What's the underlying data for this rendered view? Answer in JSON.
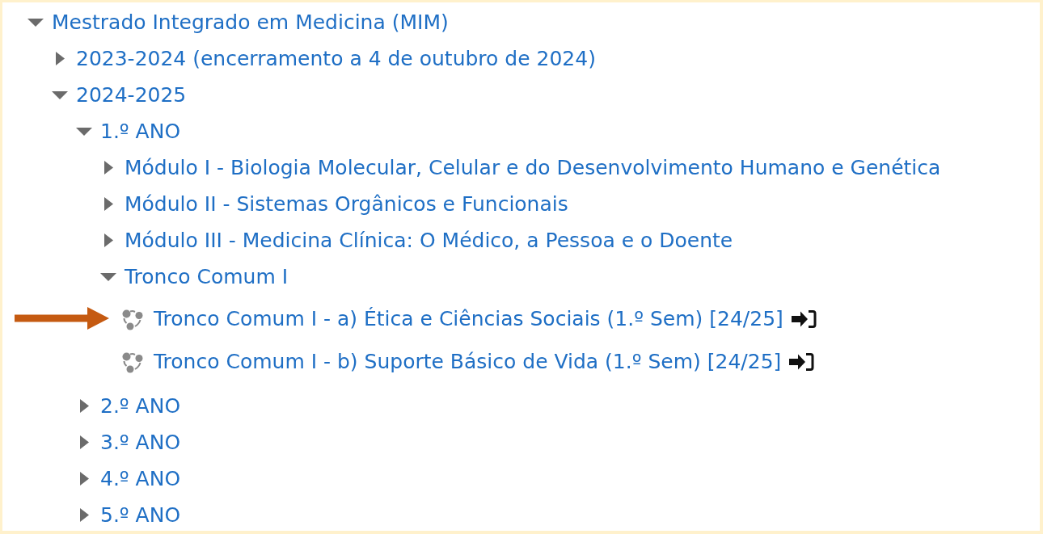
{
  "tree": [
    {
      "kind": "category",
      "label": "Mestrado Integrado em Medicina (MIM)",
      "expanded": true,
      "children": [
        {
          "kind": "category",
          "label": "2023-2024 (encerramento a 4 de outubro de 2024)",
          "expanded": false
        },
        {
          "kind": "category",
          "label": "2024-2025",
          "expanded": true,
          "children": [
            {
              "kind": "category",
              "label": "1.º ANO",
              "expanded": true,
              "children": [
                {
                  "kind": "category",
                  "label": "Módulo I - Biologia Molecular, Celular e do Desenvolvimento Humano e Genética",
                  "expanded": false
                },
                {
                  "kind": "category",
                  "label": "Módulo II - Sistemas Orgânicos e Funcionais",
                  "expanded": false
                },
                {
                  "kind": "category",
                  "label": "Módulo III - Medicina Clínica: O Médico, a Pessoa e o Doente",
                  "expanded": false
                },
                {
                  "kind": "category",
                  "label": "Tronco Comum I",
                  "expanded": true,
                  "children": [
                    {
                      "kind": "course",
                      "label": "Tronco Comum I - a) Ética e Ciências Sociais (1.º Sem) [24/25]",
                      "self_enrol": true,
                      "annotated": true
                    },
                    {
                      "kind": "course",
                      "label": "Tronco Comum I - b) Suporte Básico de Vida (1.º Sem) [24/25]",
                      "self_enrol": true,
                      "annotated": false
                    }
                  ]
                }
              ]
            },
            {
              "kind": "category",
              "label": "2.º ANO",
              "expanded": false
            },
            {
              "kind": "category",
              "label": "3.º ANO",
              "expanded": false
            },
            {
              "kind": "category",
              "label": "4.º ANO",
              "expanded": false
            },
            {
              "kind": "category",
              "label": "5.º ANO",
              "expanded": false
            }
          ]
        }
      ]
    }
  ]
}
